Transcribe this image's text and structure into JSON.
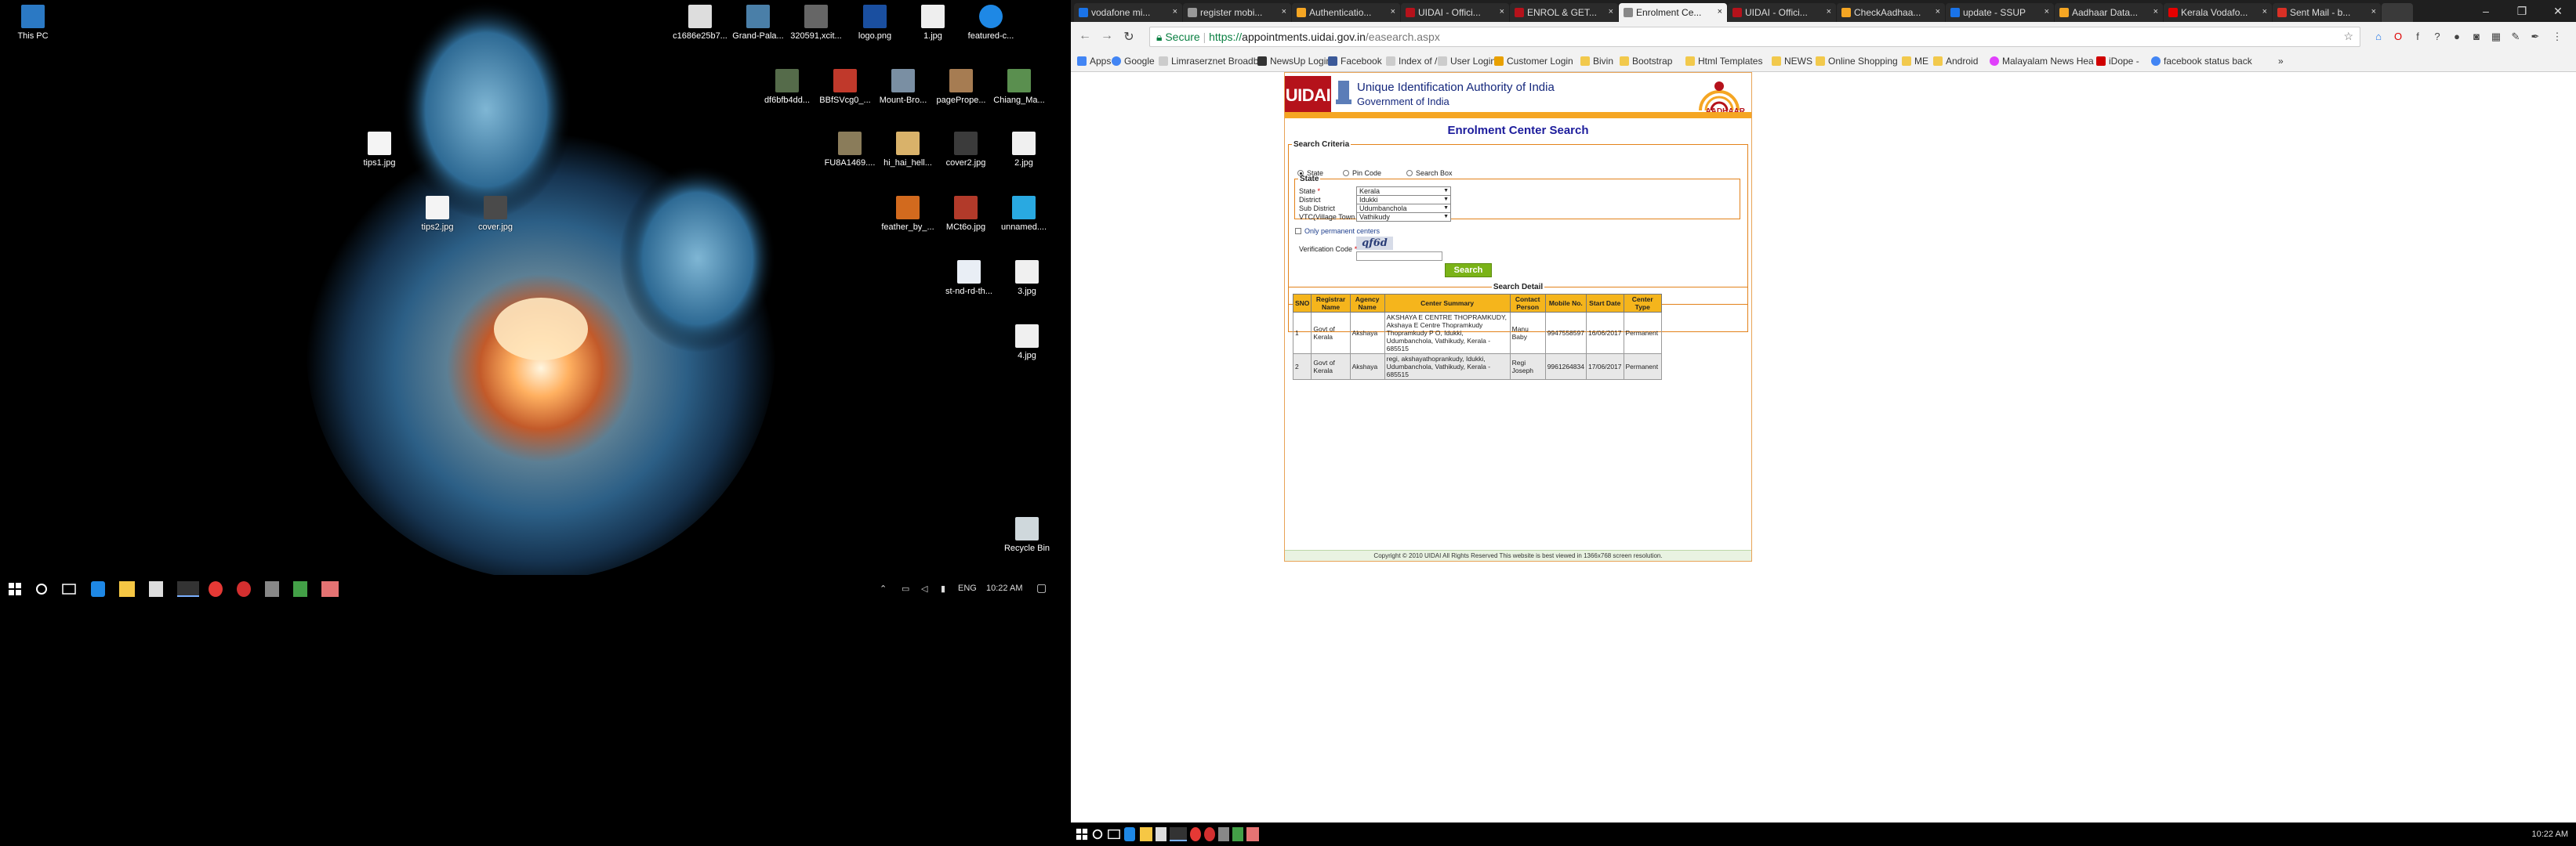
{
  "desktop_left": {
    "icons": [
      {
        "label": "This PC"
      },
      {
        "label": "c1686e25b7..."
      },
      {
        "label": "Grand-Pala..."
      },
      {
        "label": "320591,xcit..."
      },
      {
        "label": "logo.png"
      },
      {
        "label": "1.jpg"
      },
      {
        "label": "featured-c..."
      },
      {
        "label": "df6bfb4dd..."
      },
      {
        "label": "BBfSVcg0_..."
      },
      {
        "label": "Mount-Bro..."
      },
      {
        "label": "pagePrope..."
      },
      {
        "label": "Chiang_Ma..."
      },
      {
        "label": "tips1.jpg"
      },
      {
        "label": "FU8A1469...."
      },
      {
        "label": "hi_hai_hell..."
      },
      {
        "label": "cover2.jpg"
      },
      {
        "label": "2.jpg"
      },
      {
        "label": "tips2.jpg"
      },
      {
        "label": "cover.jpg"
      },
      {
        "label": "feather_by_..."
      },
      {
        "label": "MCt6o.jpg"
      },
      {
        "label": "unnamed...."
      },
      {
        "label": "st-nd-rd-th..."
      },
      {
        "label": "3.jpg"
      },
      {
        "label": "4.jpg"
      },
      {
        "label": "Recycle Bin"
      }
    ],
    "taskbar": {
      "lang": "ENG",
      "time": "10:22 AM"
    }
  },
  "browser": {
    "tabs": [
      {
        "label": "vodafone mi...",
        "color": "#1a73e8"
      },
      {
        "label": "register mobi...",
        "color": "#999999"
      },
      {
        "label": "Authenticatio...",
        "color": "#f5a623"
      },
      {
        "label": "UIDAI - Offici...",
        "color": "#b5121b"
      },
      {
        "label": "ENROL & GET...",
        "color": "#b5121b"
      },
      {
        "label": "Enrolment Ce...",
        "color": "#888888",
        "active": true
      },
      {
        "label": "UIDAI - Offici...",
        "color": "#b5121b"
      },
      {
        "label": "CheckAadhaa...",
        "color": "#f5a623"
      },
      {
        "label": "update - SSUP",
        "color": "#1a73e8"
      },
      {
        "label": "Aadhaar Data...",
        "color": "#f5a623"
      },
      {
        "label": "Kerala Vodafo...",
        "color": "#e60000"
      },
      {
        "label": "Sent Mail - b...",
        "color": "#d93025"
      }
    ],
    "url": {
      "secure_label": "Secure",
      "prefix": "https://",
      "host": "appointments.uidai.gov.in",
      "path": "/easearch.aspx"
    },
    "bookmarks": [
      {
        "label": "Apps",
        "color": "#4285f4"
      },
      {
        "label": "Google",
        "color": "#4285f4"
      },
      {
        "label": "Limraserznet Broadb",
        "color": "#cccccc"
      },
      {
        "label": "NewsUp Login",
        "color": "#333333"
      },
      {
        "label": "Facebook",
        "color": "#3b5998"
      },
      {
        "label": "Index of /",
        "color": "#cccccc"
      },
      {
        "label": "User Login",
        "color": "#cccccc"
      },
      {
        "label": "Customer Login",
        "color": "#e8a000"
      },
      {
        "label": "Bivin",
        "color": "#f2c94c"
      },
      {
        "label": "Bootstrap",
        "color": "#f2c94c"
      },
      {
        "label": "Html Templates",
        "color": "#f2c94c"
      },
      {
        "label": "NEWS",
        "color": "#f2c94c"
      },
      {
        "label": "Online Shopping",
        "color": "#f2c94c"
      },
      {
        "label": "ME",
        "color": "#f2c94c"
      },
      {
        "label": "Android",
        "color": "#f2c94c"
      },
      {
        "label": "Malayalam News Hea",
        "color": "#e040fb"
      },
      {
        "label": "iDope -",
        "color": "#d00000"
      },
      {
        "label": "facebook status back",
        "color": "#4285f4"
      }
    ]
  },
  "uidai": {
    "logo_text": "UIDAI",
    "org_name": "Unique Identification Authority of India",
    "org_gov": "Government of India",
    "aadhaar_text": "AADHAAR",
    "page_title": "Enrolment Center Search",
    "search_criteria": {
      "legend": "Search Criteria",
      "options": [
        {
          "label": "State",
          "selected": true
        },
        {
          "label": "Pin Code",
          "selected": false
        },
        {
          "label": "Search Box",
          "selected": false
        }
      ]
    },
    "state_box": {
      "legend": "State",
      "fields": [
        {
          "label": "State",
          "required": "*",
          "value": "Kerala"
        },
        {
          "label": "District",
          "required": "",
          "value": "Idukki"
        },
        {
          "label": "Sub District",
          "required": "",
          "value": "Udumbanchola"
        },
        {
          "label": "VTC(Village Town City)",
          "required": "",
          "value": "Vathikudy"
        }
      ]
    },
    "only_permanent": "Only permanent centers",
    "verification_label": "Verification Code",
    "verification_req": "*",
    "captcha": "qf6d",
    "search_button": "Search",
    "search_detail": {
      "legend": "Search Detail",
      "headers": [
        "SNO",
        "Registrar Name",
        "Agency Name",
        "Center Summary",
        "Contact Person",
        "Mobile No.",
        "Start Date",
        "Center Type"
      ],
      "rows": [
        [
          "1",
          "Govt of Kerala",
          "Akshaya",
          "AKSHAYA E CENTRE THOPRAMKUDY, Akshaya E Centre Thopramkudy Thopramkudy P O, Idukki, Udumbanchola, Vathikudy, Kerala - 685515",
          "Manu Baby",
          "9947558597",
          "16/06/2017",
          "Permanent"
        ],
        [
          "2",
          "Govt of Kerala",
          "Akshaya",
          "regi, akshayathoprankudy, Idukki, Udumbanchola, Vathikudy, Kerala - 685515",
          "Regi Joseph",
          "9961264834",
          "17/06/2017",
          "Permanent"
        ]
      ]
    },
    "footer": "Copyright © 2010 UIDAI All Rights Reserved This website is best viewed in 1366x768 screen resolution."
  },
  "taskbar_right": {
    "time": "10:22 AM"
  }
}
